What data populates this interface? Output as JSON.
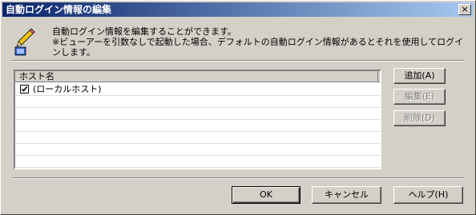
{
  "window": {
    "title": "自動ログイン情報の編集",
    "close_label": "×"
  },
  "description": {
    "line1": "自動ログイン情報を編集することができます。",
    "line2": "※ビューアーを引数なしで起動した場合、デフォルトの自動ログイン情報があるとそれを使用してログイ",
    "line3": "ンします。"
  },
  "host_list": {
    "column_header": "ホスト名",
    "rows": [
      {
        "label": "(ローカルホスト)",
        "checked": true
      }
    ]
  },
  "side_buttons": {
    "add": "追加(A)",
    "edit": "編集(E)",
    "delete": "削除(D)"
  },
  "footer_buttons": {
    "ok": "OK",
    "cancel": "キャンセル",
    "help": "ヘルプ(H)"
  }
}
